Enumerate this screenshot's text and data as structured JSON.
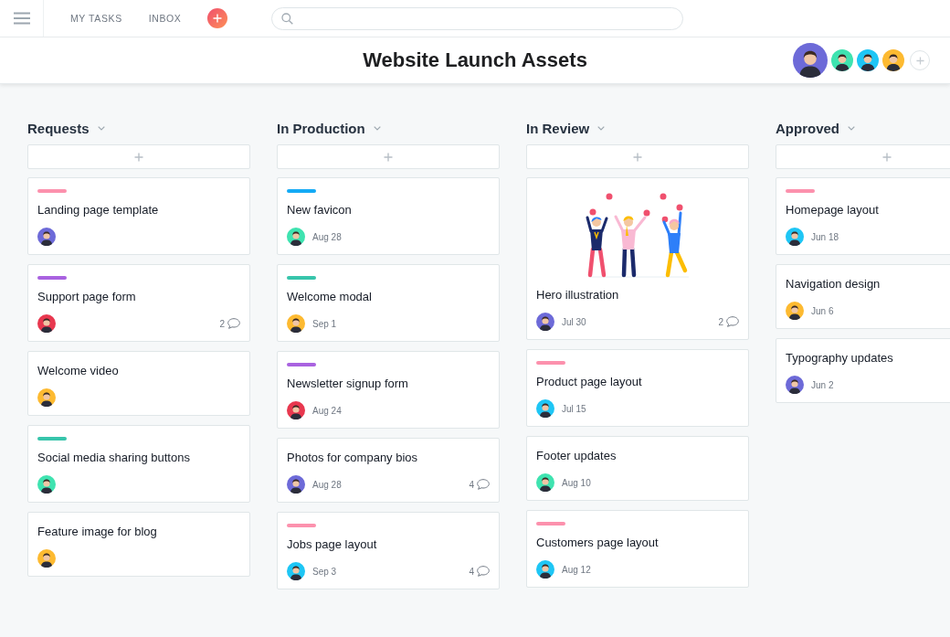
{
  "nav": [
    "MY TASKS",
    "INBOX"
  ],
  "project": {
    "title": "Website Launch Assets",
    "members": [
      {
        "kind": "owner",
        "color": "#6d6ad8"
      },
      {
        "kind": "member",
        "color": "#3fe3b0"
      },
      {
        "kind": "member",
        "color": "#1ec6f5"
      },
      {
        "kind": "member",
        "color": "#fdba31"
      }
    ]
  },
  "columns": [
    {
      "title": "Requests",
      "cards": [
        {
          "kind": "task",
          "color": "#fc91ad",
          "title": "Landing page template",
          "assignee": {
            "color": "#6d6ad8"
          }
        },
        {
          "kind": "task",
          "color": "#a962e0",
          "title": "Support page form",
          "assignee": {
            "color": "#e8384f"
          },
          "comments": "2"
        },
        {
          "kind": "task",
          "title": "Welcome video",
          "assignee": {
            "color": "#fdba31"
          }
        },
        {
          "kind": "task",
          "color": "#37c5ab",
          "title": "Social media sharing buttons",
          "assignee": {
            "color": "#3fe3b0"
          }
        },
        {
          "kind": "task",
          "title": "Feature image for blog",
          "assignee": {
            "color": "#fdba31"
          }
        }
      ]
    },
    {
      "title": "In Production",
      "cards": [
        {
          "kind": "task",
          "color": "#14aaf5",
          "title": "New favicon",
          "assignee": {
            "color": "#3fe3b0"
          },
          "due": "Aug 28"
        },
        {
          "kind": "task",
          "color": "#37c5ab",
          "title": "Welcome modal",
          "assignee": {
            "color": "#fdba31"
          },
          "due": "Sep 1"
        },
        {
          "kind": "task",
          "color": "#a962e0",
          "title": "Newsletter signup form",
          "assignee": {
            "color": "#e8384f"
          },
          "due": "Aug 24"
        },
        {
          "kind": "task",
          "title": "Photos for company bios",
          "assignee": {
            "color": "#6d6ad8"
          },
          "due": "Aug 28",
          "comments": "4"
        },
        {
          "kind": "task",
          "color": "#fc91ad",
          "title": "Jobs page layout",
          "assignee": {
            "color": "#1ec6f5"
          },
          "due": "Sep 3",
          "comments": "4"
        }
      ]
    },
    {
      "title": "In Review",
      "cards": [
        {
          "kind": "illustration",
          "title": "Hero illustration",
          "assignee": {
            "color": "#6d6ad8"
          },
          "due": "Jul 30",
          "comments": "2"
        },
        {
          "kind": "task",
          "color": "#fc91ad",
          "title": "Product page layout",
          "assignee": {
            "color": "#1ec6f5"
          },
          "due": "Jul 15"
        },
        {
          "kind": "task",
          "title": "Footer updates",
          "assignee": {
            "color": "#3fe3b0"
          },
          "due": "Aug 10"
        },
        {
          "kind": "task",
          "color": "#fc91ad",
          "title": "Customers page layout",
          "assignee": {
            "color": "#1ec6f5"
          },
          "due": "Aug 12"
        }
      ]
    },
    {
      "title": "Approved",
      "cards": [
        {
          "kind": "task",
          "color": "#fc91ad",
          "title": "Homepage layout",
          "assignee": {
            "color": "#1ec6f5"
          },
          "due": "Jun 18"
        },
        {
          "kind": "task",
          "title": "Navigation design",
          "assignee": {
            "color": "#fdba31"
          },
          "due": "Jun 6"
        },
        {
          "kind": "task",
          "title": "Typography updates",
          "assignee": {
            "color": "#6d6ad8"
          },
          "due": "Jun 2"
        }
      ]
    }
  ]
}
